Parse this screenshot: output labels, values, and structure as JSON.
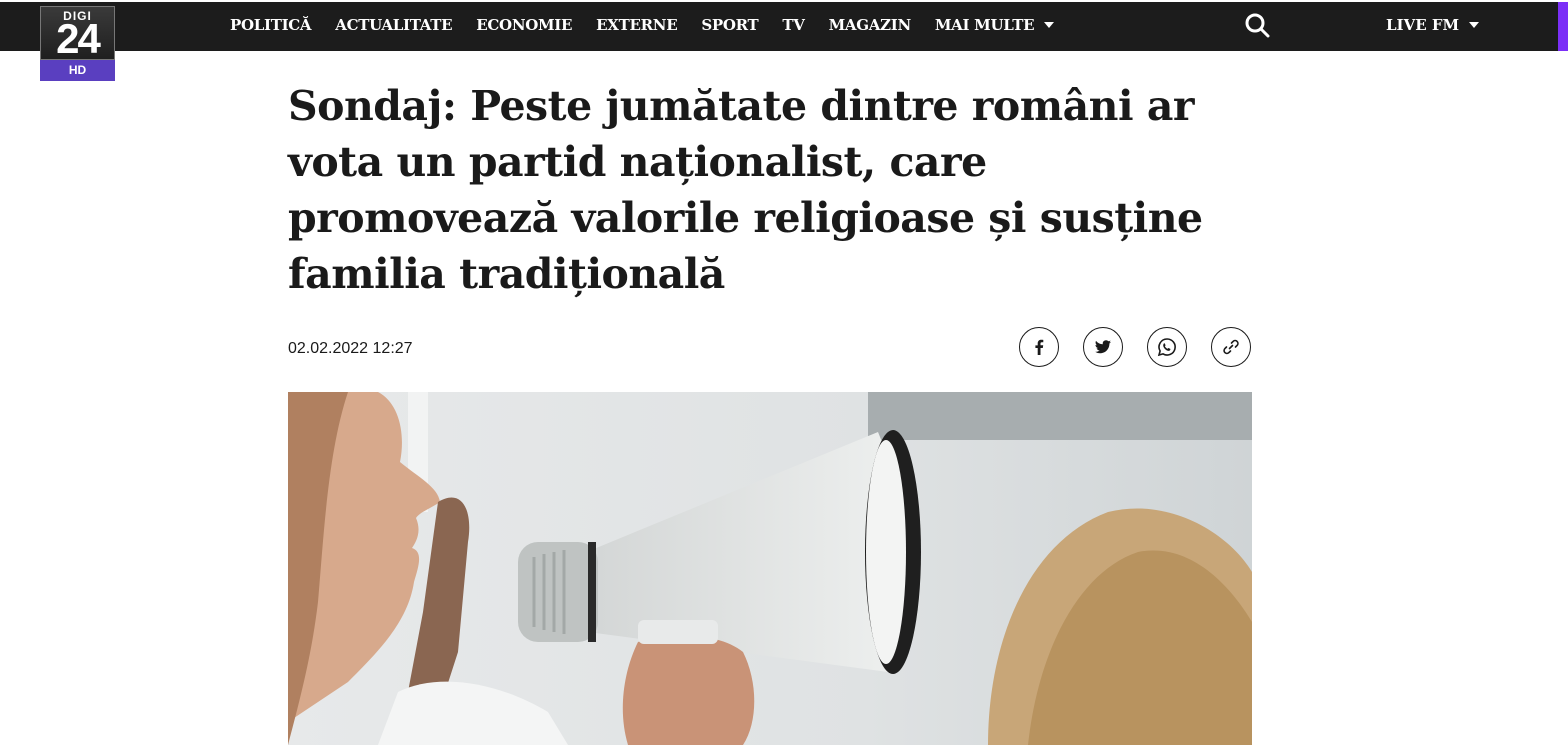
{
  "logo": {
    "line1": "DIGI",
    "line2": "24",
    "badge": "HD"
  },
  "nav": {
    "items": [
      "POLITICĂ",
      "ACTUALITATE",
      "ECONOMIE",
      "EXTERNE",
      "SPORT",
      "TV",
      "MAGAZIN"
    ],
    "more_label": "MAI MULTE",
    "live_label": "LIVE FM"
  },
  "article": {
    "headline": "Sondaj: Peste jumătate dintre români ar vota un partid naționalist, care promovează valorile religioase și susține familia tradițională",
    "datetime": "02.02.2022 12:27",
    "share_icons": [
      "facebook-icon",
      "twitter-icon",
      "whatsapp-icon",
      "link-icon"
    ]
  },
  "colors": {
    "nav_bg": "#1c1c1c",
    "accent": "#7b2ff7",
    "hd_badge": "#5a3fc0"
  }
}
